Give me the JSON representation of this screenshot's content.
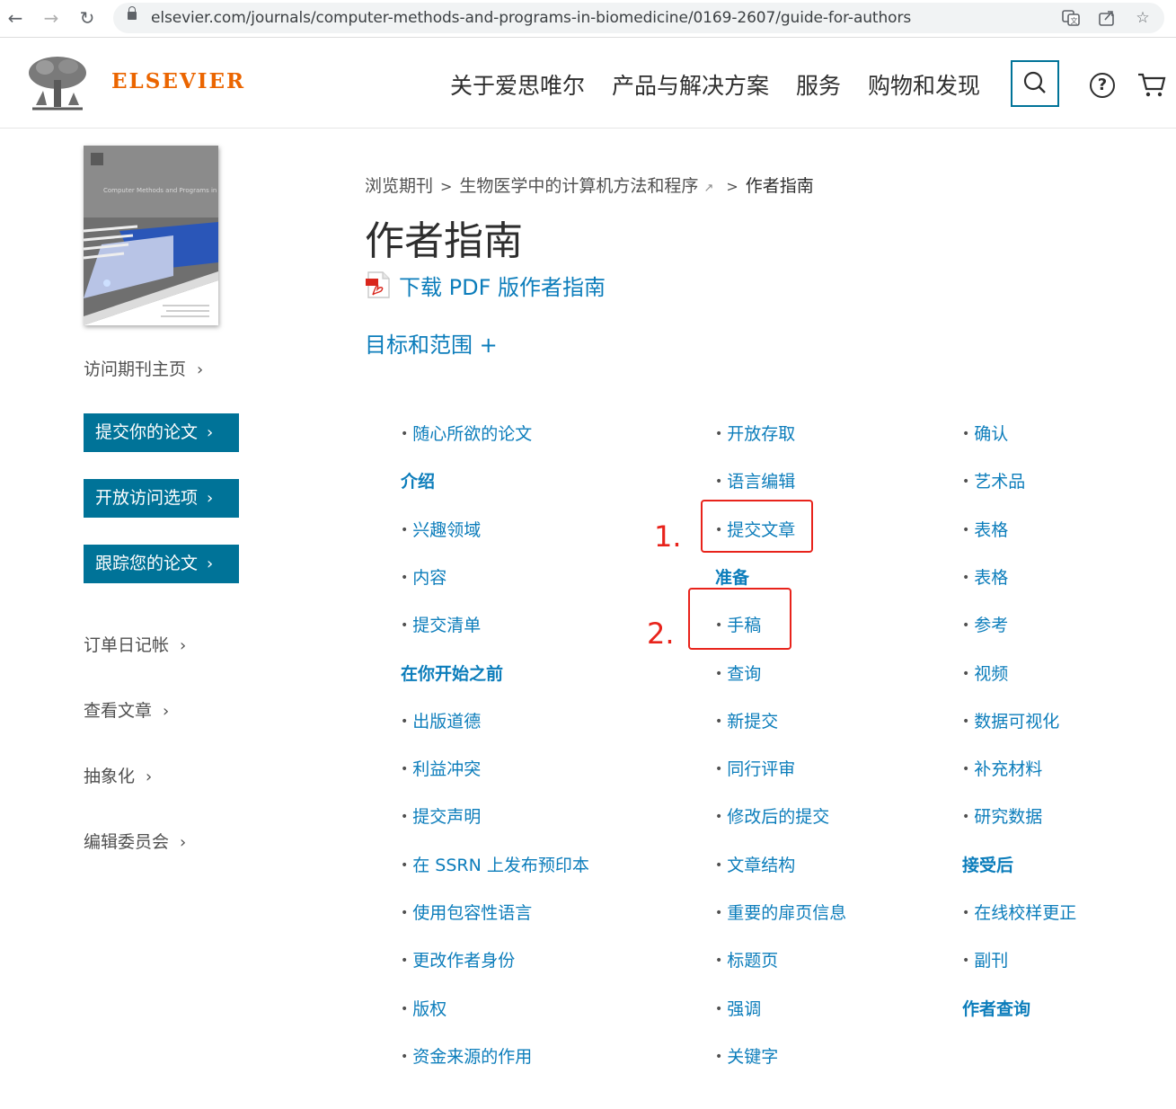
{
  "browser": {
    "url": "elsevier.com/journals/computer-methods-and-programs-in-biomedicine/0169-2607/guide-for-authors"
  },
  "header": {
    "brand": "ELSEVIER",
    "nav": [
      "关于爱思唯尔",
      "产品与解决方案",
      "服务",
      "购物和发现"
    ],
    "help_icon": "?"
  },
  "cover": {
    "title": "Computer Methods and Programs in Biomedicine"
  },
  "sidebar": {
    "visit_home": "访问期刊主页",
    "buttons": [
      "提交你的论文",
      "开放访问选项",
      "跟踪您的论文"
    ],
    "links": [
      "订单日记帐",
      "查看文章",
      "抽象化",
      "编辑委员会"
    ]
  },
  "breadcrumb": {
    "items": [
      "浏览期刊",
      "生物医学中的计算机方法和程序",
      "作者指南"
    ],
    "sep": ">"
  },
  "main": {
    "title": "作者指南",
    "pdf_link": "下载 PDF 版作者指南",
    "aims": "目标和范围 +"
  },
  "toc": {
    "col1": [
      {
        "type": "link",
        "text": "随心所欲的论文"
      },
      {
        "type": "head",
        "text": "介绍"
      },
      {
        "type": "link",
        "text": "兴趣领域"
      },
      {
        "type": "link",
        "text": "内容"
      },
      {
        "type": "link",
        "text": "提交清单"
      },
      {
        "type": "head",
        "text": "在你开始之前"
      },
      {
        "type": "link",
        "text": "出版道德"
      },
      {
        "type": "link",
        "text": "利益冲突"
      },
      {
        "type": "link",
        "text": "提交声明"
      },
      {
        "type": "link",
        "text": "在 SSRN 上发布预印本"
      },
      {
        "type": "link",
        "text": "使用包容性语言"
      },
      {
        "type": "link",
        "text": "更改作者身份"
      },
      {
        "type": "link",
        "text": "版权"
      },
      {
        "type": "link",
        "text": "资金来源的作用"
      }
    ],
    "col2": [
      {
        "type": "link",
        "text": "开放存取"
      },
      {
        "type": "link",
        "text": "语言编辑"
      },
      {
        "type": "link",
        "text": "提交文章"
      },
      {
        "type": "head",
        "text": "准备"
      },
      {
        "type": "link",
        "text": "手稿"
      },
      {
        "type": "link",
        "text": "查询"
      },
      {
        "type": "link",
        "text": "新提交"
      },
      {
        "type": "link",
        "text": "同行评审"
      },
      {
        "type": "link",
        "text": "修改后的提交"
      },
      {
        "type": "link",
        "text": "文章结构"
      },
      {
        "type": "link",
        "text": "重要的扉页信息"
      },
      {
        "type": "link",
        "text": "标题页"
      },
      {
        "type": "link",
        "text": "强调"
      },
      {
        "type": "link",
        "text": "关键字"
      }
    ],
    "col3": [
      {
        "type": "link",
        "text": "确认"
      },
      {
        "type": "link",
        "text": "艺术品"
      },
      {
        "type": "link",
        "text": "表格"
      },
      {
        "type": "link",
        "text": "表格"
      },
      {
        "type": "link",
        "text": "参考"
      },
      {
        "type": "link",
        "text": "视频"
      },
      {
        "type": "link",
        "text": "数据可视化"
      },
      {
        "type": "link",
        "text": "补充材料"
      },
      {
        "type": "link",
        "text": "研究数据"
      },
      {
        "type": "head",
        "text": "接受后"
      },
      {
        "type": "link",
        "text": "在线校样更正"
      },
      {
        "type": "link",
        "text": "副刊"
      },
      {
        "type": "head",
        "text": "作者查询"
      }
    ]
  },
  "annotations": {
    "step1": "1.",
    "step2": "2.",
    "color": "#e8231b"
  },
  "colors": {
    "brand": "#eb6500",
    "accent": "#007398",
    "link": "#0c7dbb"
  }
}
